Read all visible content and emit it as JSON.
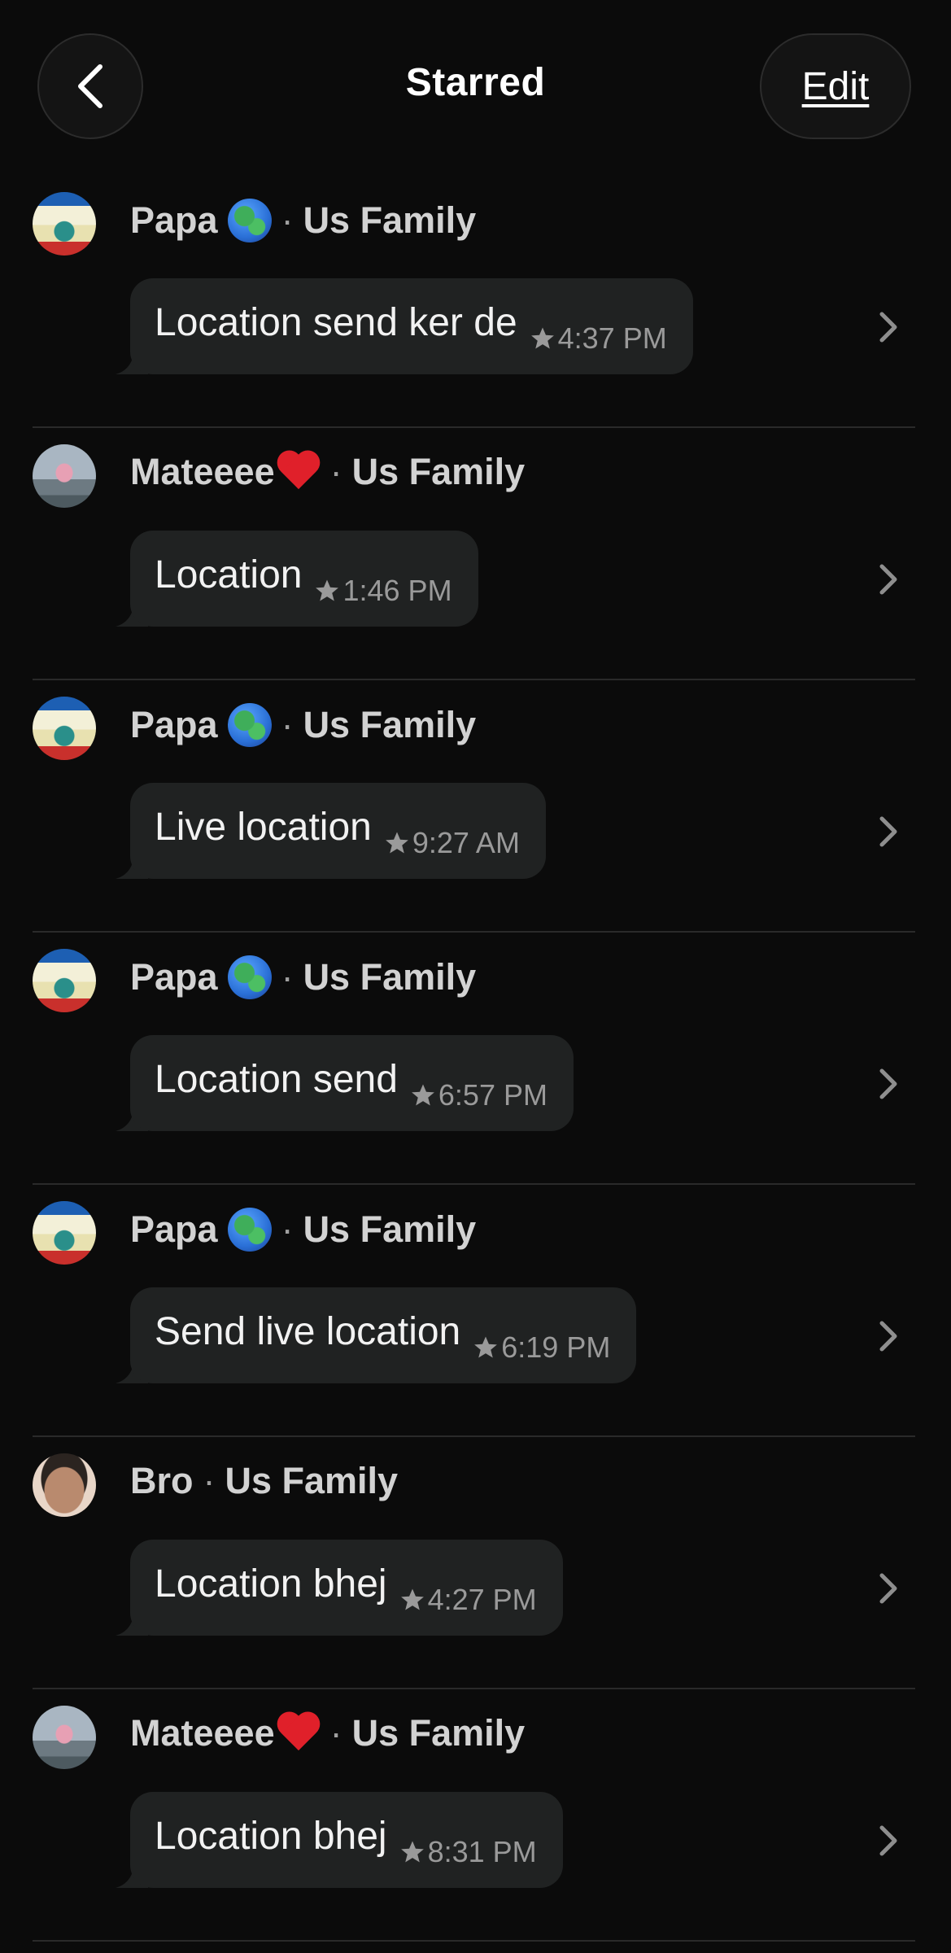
{
  "header": {
    "title": "Starred",
    "edit_label": "Edit"
  },
  "messages": [
    {
      "sender": "Papa",
      "sender_emoji": "globe",
      "group": "Us Family",
      "text": "Location send ker de",
      "time": "4:37 PM",
      "starred": true,
      "avatar": "papa"
    },
    {
      "sender": "Mateeee",
      "sender_emoji": "heart",
      "group": "Us Family",
      "text": "Location",
      "time": "1:46 PM",
      "starred": true,
      "avatar": "mateeee"
    },
    {
      "sender": "Papa",
      "sender_emoji": "globe",
      "group": "Us Family",
      "text": "Live location",
      "time": "9:27 AM",
      "starred": true,
      "avatar": "papa"
    },
    {
      "sender": "Papa",
      "sender_emoji": "globe",
      "group": "Us Family",
      "text": "Location send",
      "time": "6:57 PM",
      "starred": true,
      "avatar": "papa"
    },
    {
      "sender": "Papa",
      "sender_emoji": "globe",
      "group": "Us Family",
      "text": "Send live location",
      "time": "6:19 PM",
      "starred": true,
      "avatar": "papa"
    },
    {
      "sender": "Bro",
      "sender_emoji": "",
      "group": "Us Family",
      "text": "Location bhej",
      "time": "4:27 PM",
      "starred": true,
      "avatar": "bro"
    },
    {
      "sender": "Mateeee",
      "sender_emoji": "heart",
      "group": "Us Family",
      "text": "Location bhej",
      "time": "8:31 PM",
      "starred": true,
      "avatar": "mateeee"
    }
  ],
  "colors": {
    "background": "#0b0b0b",
    "bubble": "#202222",
    "meta": "#9a9a9a",
    "heart": "#e0202a"
  }
}
